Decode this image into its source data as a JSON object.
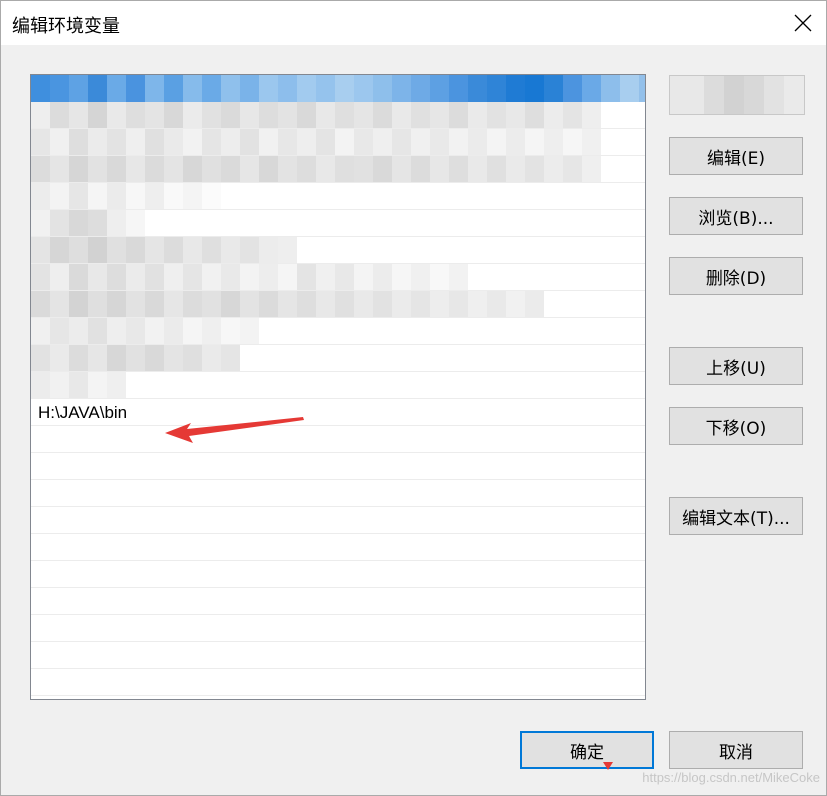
{
  "dialog": {
    "title": "编辑环境变量"
  },
  "list": {
    "visible_entry": "H:\\JAVA\\bin"
  },
  "buttons": {
    "edit": "编辑(E)",
    "browse": "浏览(B)...",
    "delete": "删除(D)",
    "move_up": "上移(U)",
    "move_down": "下移(O)",
    "edit_text": "编辑文本(T)...",
    "ok": "确定",
    "cancel": "取消"
  },
  "watermark": "https://blog.csdn.net/MikeCoke",
  "colors": {
    "selection": "#93c0ea",
    "accent": "#0078d7",
    "annotation_arrow": "#e53935"
  }
}
